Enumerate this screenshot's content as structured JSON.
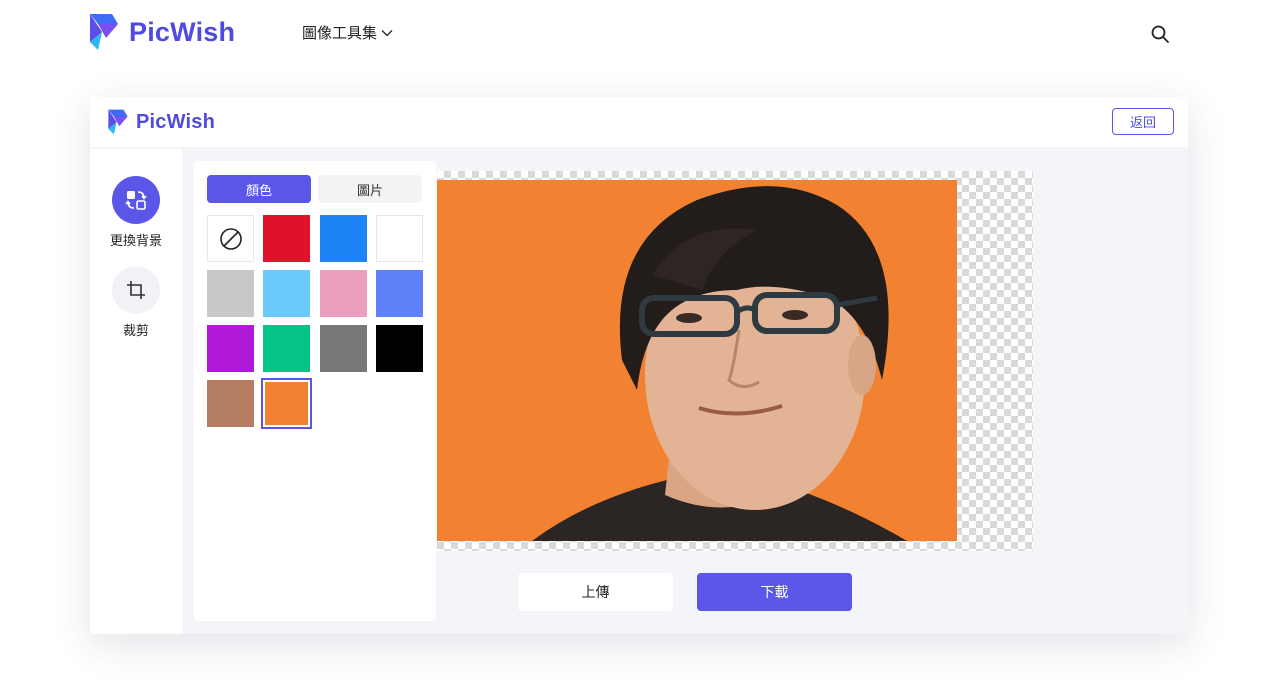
{
  "site": {
    "brand": "PicWish",
    "nav_tools_label": "圖像工具集",
    "search_icon": "search-icon"
  },
  "app": {
    "brand": "PicWish",
    "back_label": "返回",
    "rail": {
      "change_bg_label": "更換背景",
      "crop_label": "裁剪"
    },
    "panel": {
      "tab_color": "顏色",
      "tab_image": "圖片",
      "swatches": [
        "none",
        "#e0122a",
        "#1e84f5",
        "#ffffff",
        "#c8c8c8",
        "#6bc8fb",
        "#eb9fbf",
        "#5e80f8",
        "#b019d6",
        "#06c487",
        "#777777",
        "#000000",
        "#b67d65",
        "#f28231"
      ],
      "selected_swatch": "#f28231"
    },
    "canvas": {
      "background_color": "#f28231"
    },
    "upload_label": "上傳",
    "download_label": "下載"
  },
  "colors": {
    "accent": "#5b55e8",
    "brand_text": "#4f4ae0"
  }
}
